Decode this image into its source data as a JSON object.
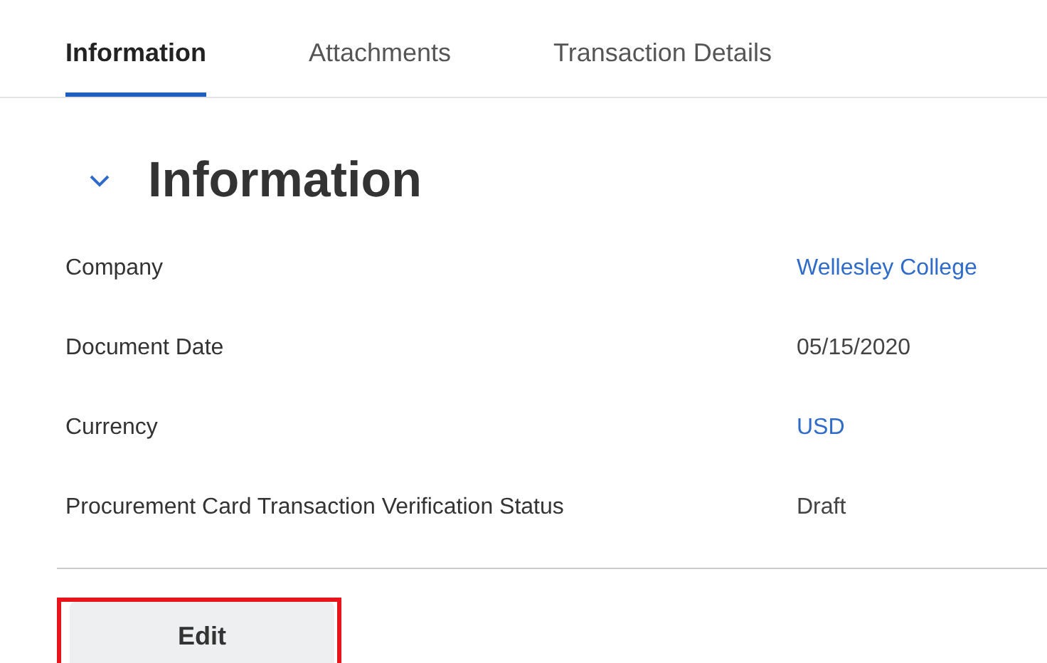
{
  "tabs": [
    {
      "label": "Information",
      "selected": true
    },
    {
      "label": "Attachments",
      "selected": false
    },
    {
      "label": "Transaction Details",
      "selected": false
    }
  ],
  "section": {
    "title": "Information",
    "expanded": true
  },
  "fields": [
    {
      "label": "Company",
      "value": "Wellesley College",
      "kind": "link"
    },
    {
      "label": "Document Date",
      "value": "05/15/2020",
      "kind": "text"
    },
    {
      "label": "Currency",
      "value": "USD",
      "kind": "link"
    },
    {
      "label": "Procurement Card Transaction Verification Status",
      "value": "Draft",
      "kind": "text"
    }
  ],
  "edit_button": {
    "label": "Edit",
    "highlighted": true
  }
}
